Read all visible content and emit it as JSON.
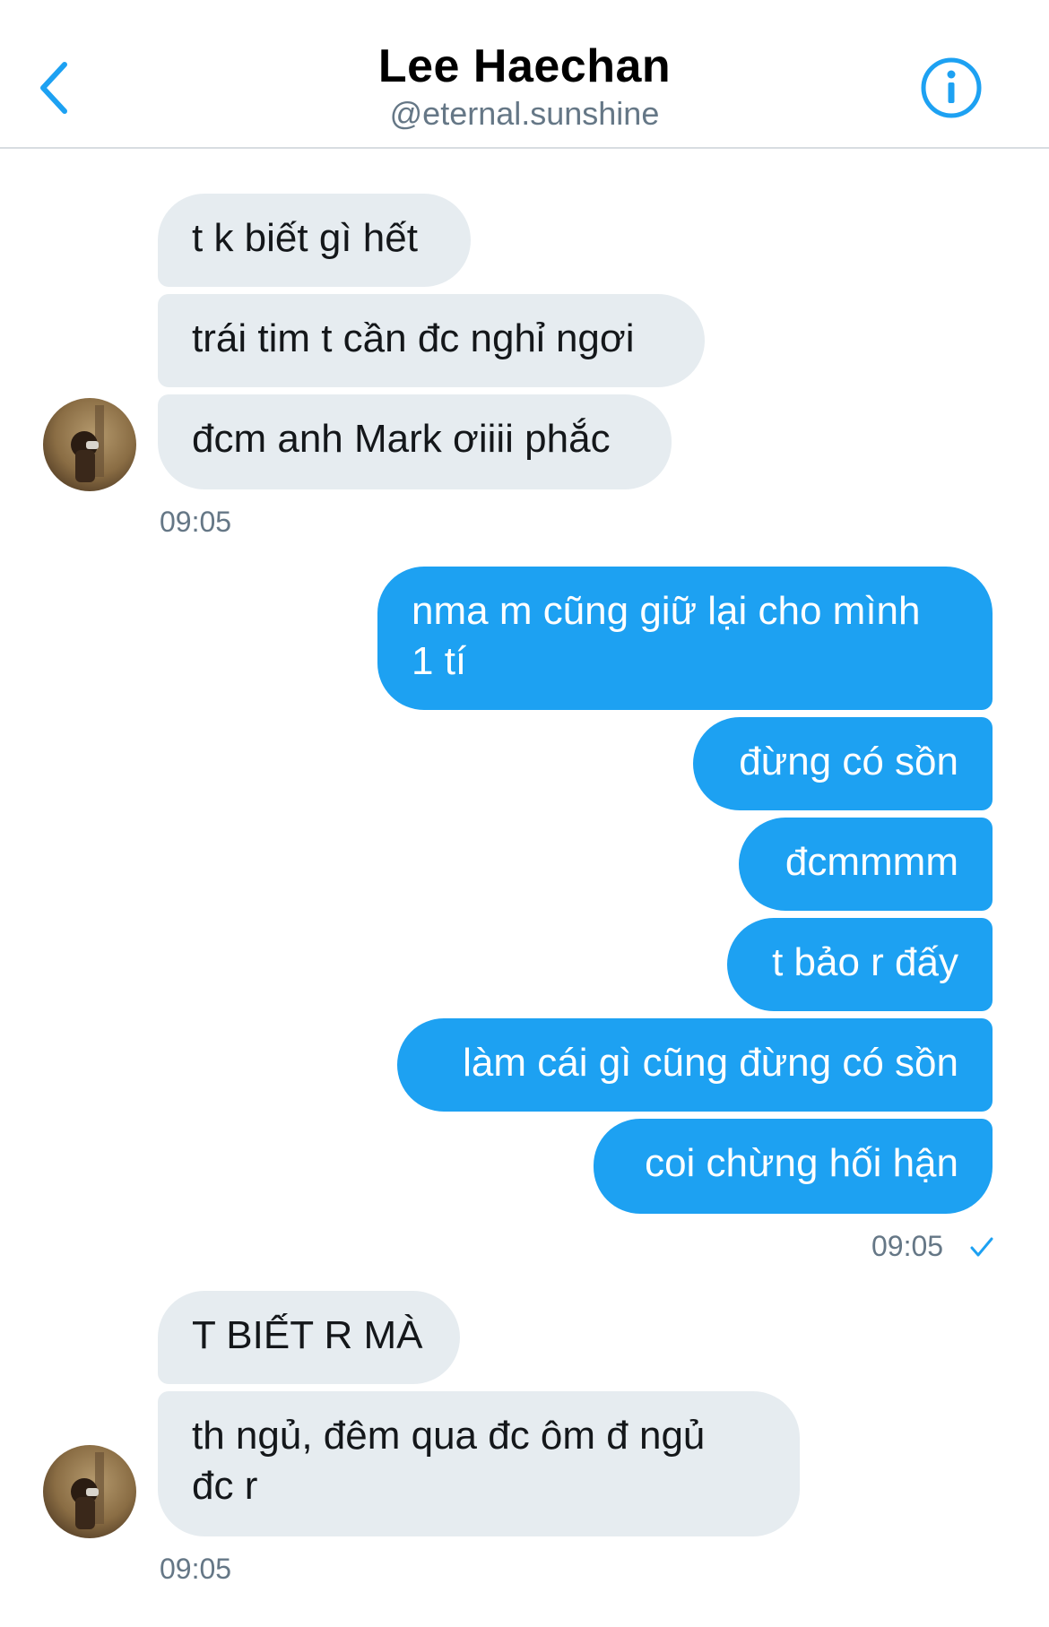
{
  "header": {
    "back_icon": "chevron-left-icon",
    "title": "Lee Haechan",
    "subtitle": "@eternal.sunshine",
    "info_icon": "info-icon",
    "accent_color": "#1da1f2"
  },
  "messages": {
    "group1": {
      "m1": "t k biết gì hết",
      "m2": "trái tim t cần đc nghỉ ngơi",
      "m3": "đcm anh Mark ơiiii phắc",
      "time": "09:05"
    },
    "group2": {
      "m1_line1": "nma m cũng giữ lại cho mình",
      "m1_line2": "1 tí",
      "m2": "đừng có sồn",
      "m3": "đcmmmm",
      "m4": "t bảo r đấy",
      "m5": "làm cái gì cũng đừng có sồn",
      "m6": "coi chừng hối hận",
      "time": "09:05",
      "status_icon": "checkmark-icon"
    },
    "group3": {
      "m1": "T BIẾT R MÀ",
      "m2_line1": "th ngủ, đêm qua đc ôm đ ngủ",
      "m2_line2": "đc r",
      "time": "09:05"
    }
  },
  "colors": {
    "incoming_bubble": "#e6ecf0",
    "outgoing_bubble": "#1da1f2",
    "timestamp": "#657786"
  }
}
